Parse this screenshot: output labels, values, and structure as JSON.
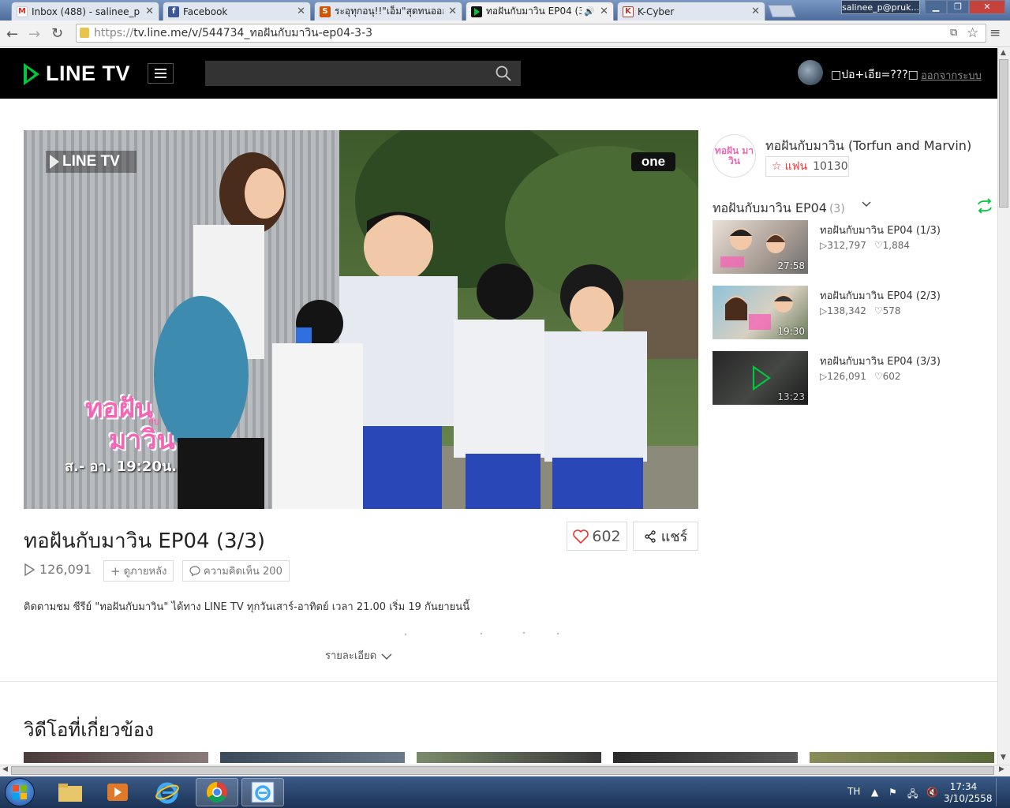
{
  "browser": {
    "tabs": [
      {
        "title": "Inbox (488) - salinee_p@p",
        "favicon": "gmail-icon",
        "color": "#d93025"
      },
      {
        "title": "Facebook",
        "favicon": "facebook-icon",
        "color": "#3b5998"
      },
      {
        "title": "ระอุทุกอนุ!!\"เอ็ม\"สุดทนออกโร",
        "favicon": "site-icon",
        "color": "#d35400"
      },
      {
        "title": "ทอฝันกับมาวิน EP04 (3/3",
        "favicon": "linetv-icon",
        "color": "#00c73c"
      },
      {
        "title": "K-Cyber",
        "favicon": "kcyber-icon",
        "color": "#c0392b"
      }
    ],
    "profile": "salinee_p@pruk...",
    "url_prefix": "https://",
    "url": "tv.line.me/v/544734_ทอฝันกับมาวิน-ep04-3-3"
  },
  "site": {
    "logo": "LINE TV",
    "search_placeholder": "",
    "username": "□ปอ+เอีย=???□",
    "logout": "ออกจากระบบ",
    "brand_color": "#00c73c"
  },
  "player": {
    "watermark": "LINE TV",
    "channel_badge": "one",
    "show_title": "ทอฝัน",
    "show_title2": "มาวิน",
    "show_title_small": "กับ",
    "schedule": "ส.- อา. 19:20น."
  },
  "video": {
    "title": "ทอฝันกับมาวิน EP04 (3/3)",
    "likes": "602",
    "share": "แชร์",
    "views": "126,091",
    "watch_later": "ดูภายหลัง",
    "comments": "ความคิดเห็น 200",
    "description": "ติดตามชม ซีรีย์ \"ทอฝันกับมาวิน\" ได้ทาง LINE TV ทุกวันเสาร์-อาทิตย์ เวลา 21.00 เริ่ม 19 กันยายนนี้",
    "more": "รายละเอียด"
  },
  "channel": {
    "logo_text": "ทอฝัน มาวิน",
    "name": "ทอฝันกับมาวิน (Torfun and Marvin)",
    "fan_label": "แฟน",
    "fan_count": "10130"
  },
  "playlist": {
    "title": "ทอฝันกับมาวิน EP04",
    "count": "(3)",
    "items": [
      {
        "title": "ทอฝันกับมาวิน EP04 (1/3)",
        "views": "312,797",
        "likes": "1,884",
        "duration": "27:58"
      },
      {
        "title": "ทอฝันกับมาวิน EP04 (2/3)",
        "views": "138,342",
        "likes": "578",
        "duration": "19:30"
      },
      {
        "title": "ทอฝันกับมาวิน EP04 (3/3)",
        "views": "126,091",
        "likes": "602",
        "duration": "13:23"
      }
    ]
  },
  "related": {
    "heading": "วิดีโอที่เกี่ยวข้อง"
  },
  "taskbar": {
    "lang": "TH",
    "time": "17:34",
    "date": "3/10/2558"
  }
}
